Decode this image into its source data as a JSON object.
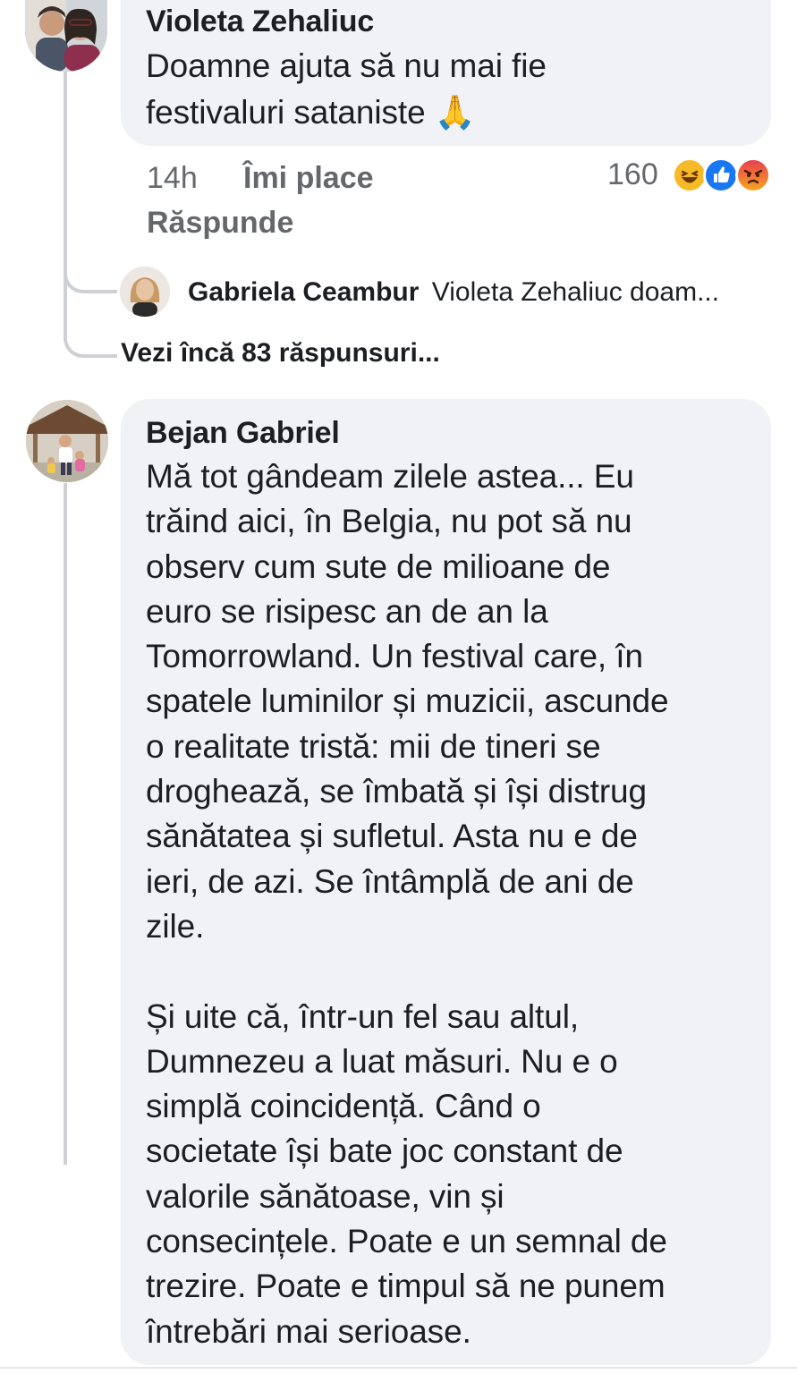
{
  "comments": [
    {
      "author": "Violeta Zehaliuc",
      "text": "Doamne ajuta să nu mai fie\nfestivaluri sataniste 🙏",
      "time": "14h",
      "like_label": "Îmi place",
      "reply_label": "Răspunde",
      "reaction_count": "160",
      "reactions": [
        "haha-icon",
        "like-icon",
        "angry-icon"
      ],
      "reply_preview": {
        "author": "Gabriela Ceambur",
        "text": "Violeta Zehaliuc doam..."
      },
      "more_replies": "Vezi încă 83 răspunsuri..."
    },
    {
      "author": "Bejan Gabriel",
      "text": "Mă tot gândeam zilele astea... Eu\ntrăind aici, în Belgia, nu pot să nu\nobserv cum sute de milioane de\neuro se risipesc an de an la\nTomorrowland. Un festival care, în\nspatele luminilor și muzicii, ascunde\no realitate tristă: mii de tineri se\ndroghează, se îmbată și își distrug\nsănătatea și sufletul. Asta nu e de\nieri, de azi. Se întâmplă de ani de\nzile.\n\nȘi uite că, într-un fel sau altul,\nDumnezeu a luat măsuri. Nu e o\nsimplă coincidență. Când o\nsocietate își bate joc constant de\nvalorile sănătoase, vin și\nconsecințele. Poate e un semnal de\ntrezire. Poate e timpul să ne punem\nîntrebări mai serioase."
    }
  ],
  "colors": {
    "bubble": "#f0f2f5",
    "meta_text": "#65676b",
    "thread_line": "#ced0d4",
    "like_blue": "#1877f2",
    "haha_yellow": "#f7b928",
    "angry_red": "#e9710f"
  }
}
